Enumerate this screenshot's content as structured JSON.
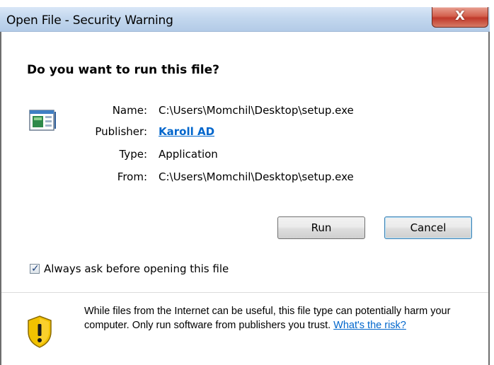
{
  "window": {
    "title": "Open File - Security Warning",
    "close_glyph": "X"
  },
  "dialog": {
    "heading": "Do you want to run this file?",
    "file_icon": "application-window-icon",
    "fields": {
      "name_label": "Name:",
      "name_value": "C:\\Users\\Momchil\\Desktop\\setup.exe",
      "publisher_label": "Publisher:",
      "publisher_value": "Karoll AD",
      "type_label": "Type:",
      "type_value": "Application",
      "from_label": "From:",
      "from_value": "C:\\Users\\Momchil\\Desktop\\setup.exe"
    },
    "buttons": {
      "run": "Run",
      "cancel": "Cancel"
    },
    "checkbox": {
      "label": "Always ask before opening this file",
      "checked": true
    },
    "warning": {
      "icon": "shield-warning-icon",
      "text": "While files from the Internet can be useful, this file type can potentially harm your computer. Only run software from publishers you trust. ",
      "link": "What's the risk?"
    }
  },
  "colors": {
    "link": "#0066cc",
    "titlebar": "#c3d7ee",
    "close_button": "#c0392b",
    "shield_yellow": "#f2c200"
  }
}
